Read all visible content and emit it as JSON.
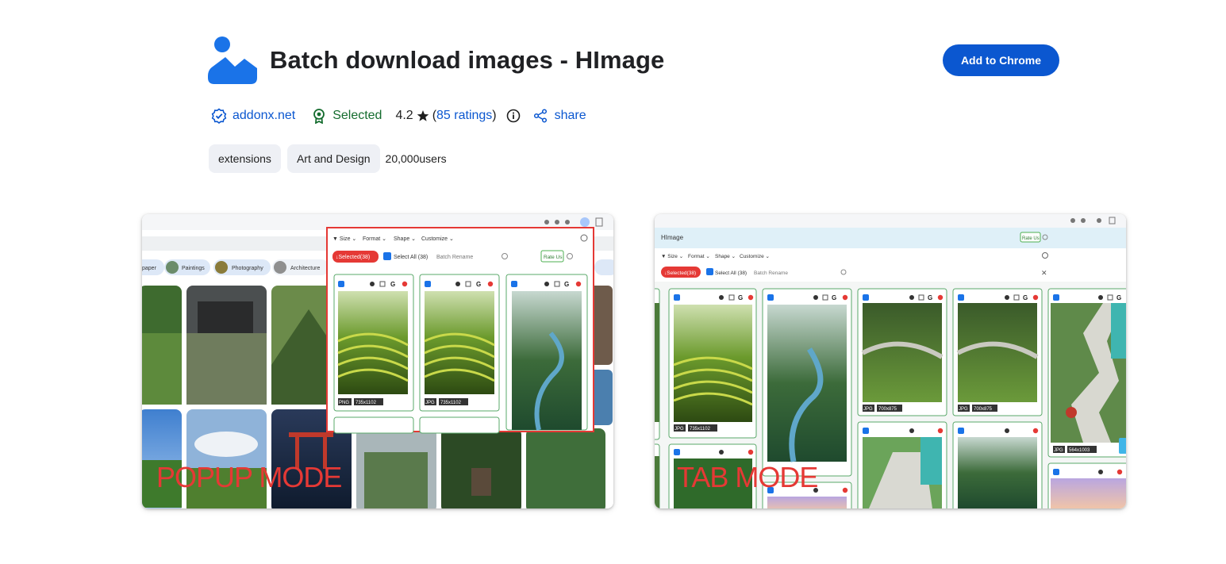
{
  "header": {
    "title": "Batch download images - HImage",
    "add_button": "Add to Chrome",
    "logo_icon": "mountain-image-icon",
    "brand_color": "#1a73e8"
  },
  "meta": {
    "publisher": "addonx.net",
    "badge": "Selected",
    "rating": "4.2",
    "ratings_open": "(",
    "ratings_link": "85 ratings",
    "ratings_close": ")",
    "share": "share",
    "icons": [
      "verified-icon",
      "award-icon",
      "star-icon",
      "info-icon",
      "share-icon"
    ]
  },
  "chips": {
    "category": "extensions",
    "subcategory": "Art and Design",
    "users": "20,000users"
  },
  "screenshots": {
    "popup": {
      "label": "POPUP MODE",
      "filters": [
        "Size",
        "Format",
        "Shape",
        "Customize"
      ],
      "selected": "Selected(38)",
      "select_all": "Select All (38)",
      "rename": "Batch Rename",
      "rate": "Rate Us",
      "tags": [
        "Paper",
        "Paintings",
        "Photography",
        "Architecture"
      ],
      "cards": [
        {
          "format": "PNG",
          "size": "735x1102"
        },
        {
          "format": "JPG",
          "size": "735x1102"
        }
      ]
    },
    "tab": {
      "label": "TAB MODE",
      "app_name": "HImage",
      "filters": [
        "Size",
        "Format",
        "Shape",
        "Customize"
      ],
      "selected": "Selected(38)",
      "select_all": "Select All (38)",
      "rename": "Batch Rename",
      "rate": "Rate Us",
      "cards": [
        {
          "format": "JPG",
          "size": "735x1102"
        },
        {
          "format": "JPG",
          "size": "700x875"
        },
        {
          "format": "JPG",
          "size": "700x875"
        },
        {
          "format": "JPG",
          "size": "564x1003"
        }
      ]
    }
  }
}
